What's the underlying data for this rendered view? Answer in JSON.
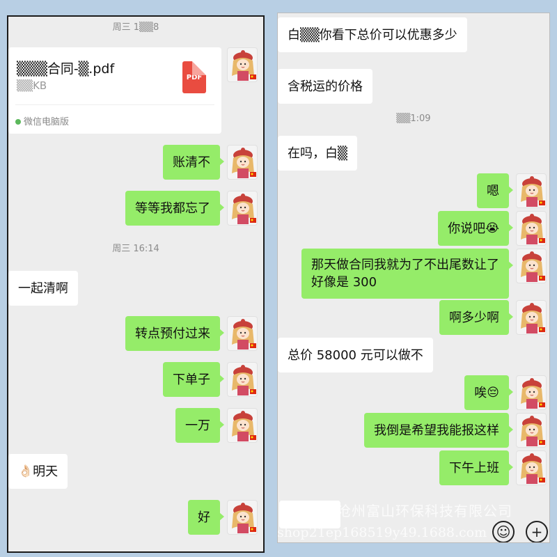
{
  "left_panel": {
    "timestamps": [
      "周三 1▒▒8",
      "周三 16:14"
    ],
    "file_card": {
      "file_name": "▒▒▒合同-▒.pdf",
      "file_size": "▒▒KB",
      "file_icon": "pdf-icon",
      "icon_label": "PDF",
      "source": "微信电脑版"
    },
    "messages": [
      {
        "side": "sent",
        "text": "账清不"
      },
      {
        "side": "sent",
        "text": "等等我都忘了"
      },
      {
        "side": "recv",
        "text": "一起清啊"
      },
      {
        "side": "sent",
        "text": "转点预付过来"
      },
      {
        "side": "sent",
        "text": "下单子"
      },
      {
        "side": "sent",
        "text": "一万"
      },
      {
        "side": "recv",
        "emoji": "👌🏻",
        "text": "明天"
      },
      {
        "side": "sent",
        "text": "好"
      }
    ]
  },
  "right_panel": {
    "timestamp": "▒▒1:09",
    "messages": [
      {
        "side": "recv",
        "text": "白▒▒你看下总价可以优惠多少"
      },
      {
        "side": "recv",
        "text": "含税运的价格"
      },
      {
        "side": "recv",
        "text": "在吗，白▒"
      },
      {
        "side": "sent",
        "text": "嗯"
      },
      {
        "side": "sent",
        "text": "你说吧",
        "emoji": "😭"
      },
      {
        "side": "sent",
        "lines": [
          "那天做合同我就为了不出尾数让了",
          "好像是 300"
        ]
      },
      {
        "side": "sent",
        "text": "啊多少啊"
      },
      {
        "side": "recv",
        "text": "总价 58000 元可以做不"
      },
      {
        "side": "sent",
        "text": "唉",
        "emoji": "😔"
      },
      {
        "side": "sent",
        "text": "我倒是希望我能报这样"
      },
      {
        "side": "sent",
        "text": "下午上班"
      }
    ],
    "toolbar": {
      "emoji_button_icon": "emoji-smile-icon",
      "emoji_button_glyph": "☺",
      "plus_button_icon": "plus-circle-icon",
      "plus_button_glyph": "+"
    }
  },
  "watermark": {
    "company": "沧州富山环保科技有限公司",
    "url": "shop21ep168519y49.1688.com"
  },
  "colors": {
    "background": "#b8cfe4",
    "chat_bg": "#ededed",
    "sent_bubble": "#95ec69",
    "recv_bubble": "#ffffff",
    "pdf_red": "#e94c40"
  }
}
